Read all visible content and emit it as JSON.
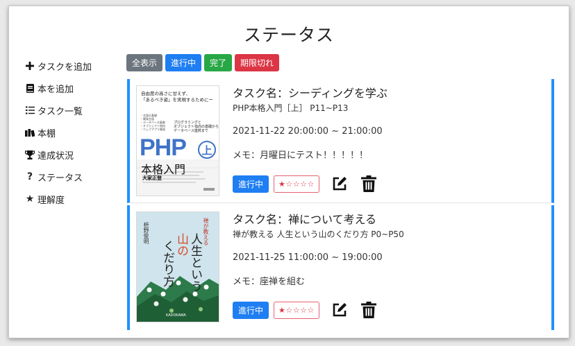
{
  "page": {
    "title": "ステータス"
  },
  "sidebar": {
    "items": [
      {
        "icon": "plus-icon",
        "label": "タスクを追加"
      },
      {
        "icon": "book-icon",
        "label": "本を追加"
      },
      {
        "icon": "list-icon",
        "label": "タスク一覧"
      },
      {
        "icon": "bookshelf-icon",
        "label": "本棚"
      },
      {
        "icon": "trophy-icon",
        "label": "達成状況"
      },
      {
        "icon": "question-icon",
        "label": "ステータス"
      },
      {
        "icon": "star-icon",
        "label": "理解度"
      }
    ]
  },
  "filters": {
    "all": "全表示",
    "in_progress": "進行中",
    "done": "完了",
    "expired": "期限切れ",
    "colors": {
      "all": "#6c757d",
      "in_progress": "#1e7ef2",
      "done": "#28a745",
      "expired": "#dc3545"
    }
  },
  "tasks": [
    {
      "name": "タスク名：シーディングを学ぶ",
      "book": "PHP本格入門［上］ P11~P13",
      "time": "2021-11-22 20:00:00 ~ 21:00:00",
      "memo": "メモ：月曜日にテスト！！！！！",
      "status": "進行中",
      "stars": "★☆☆☆☆",
      "rating": 1,
      "cover": {
        "top_line1": "自由度の高さに甘えず、",
        "top_line2": "「あるべき姿」を実現するためにー",
        "small_left": "・言語の基礎\n・開発言語\n・データベース基礎\n・オブジェクト指向\n・ウェブアプリ開発",
        "small_right": "プログラミングと\nオブジェクト指向の基礎から\nデータベース連携まで",
        "logo": "PHP",
        "logo_kanji": "上",
        "title": "本格入門",
        "author": "大家正登"
      }
    },
    {
      "name": "タスク名：禅について考える",
      "book": "禅が教える 人生という山のくだり方 P0~P50",
      "time": "2021-11-25 11:00:00 ~ 19:00:00",
      "memo": "メモ：座禅を組む",
      "status": "進行中",
      "stars": "★☆☆☆☆",
      "rating": 1,
      "cover": {
        "subtitle": "禅が教える",
        "title_a": "人生という",
        "title_b": "山の",
        "title_c": "くだり方",
        "author": "枡野俊明",
        "publisher": "KADOKAWA"
      }
    }
  ]
}
